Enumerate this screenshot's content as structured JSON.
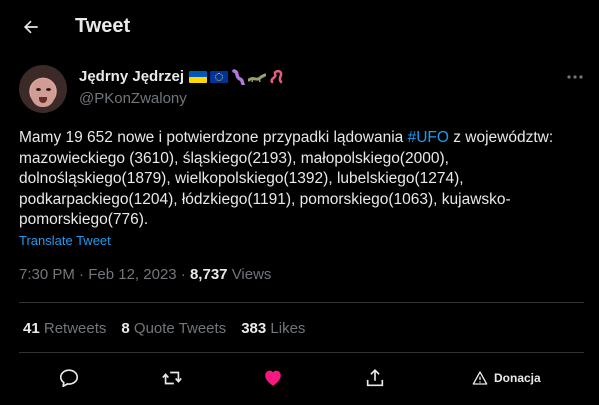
{
  "header": {
    "title": "Tweet"
  },
  "author": {
    "display_name": "Jędrny Jędrzej",
    "handle": "@PKonZwalony",
    "name_emojis": [
      "flag-ukraine",
      "flag-eu",
      "worm",
      "lizard",
      "snake"
    ]
  },
  "tweet": {
    "text_before": "Mamy 19 652 nowe i potwierdzone przypadki lądowania ",
    "hashtag": "#UFO",
    "text_after": " z województw: mazowieckiego (3610), śląskiego(2193), małopolskiego(2000), dolnośląskiego(1879), wielkopolskiego(1392), lubelskiego(1274), podkarpackiego(1204), łódzkiego(1191), pomorskiego(1063), kujawsko-pomorskiego(776).",
    "translate_label": "Translate Tweet"
  },
  "meta": {
    "time": "7:30 PM",
    "separator": "·",
    "date": "Feb 12, 2023",
    "views_count": "8,737",
    "views_label": "Views"
  },
  "stats": {
    "retweets_count": "41",
    "retweets_label": "Retweets",
    "quotes_count": "8",
    "quotes_label": "Quote Tweets",
    "likes_count": "383",
    "likes_label": "Likes"
  },
  "actions": {
    "reply_icon": "reply-icon",
    "retweet_icon": "retweet-icon",
    "like_icon": "heart-icon",
    "share_icon": "share-icon",
    "donate_label": "Donacja"
  },
  "colors": {
    "background": "#000000",
    "text": "#e7e9ea",
    "muted": "#71767b",
    "accent": "#1d9bf0",
    "like": "#f91880"
  }
}
